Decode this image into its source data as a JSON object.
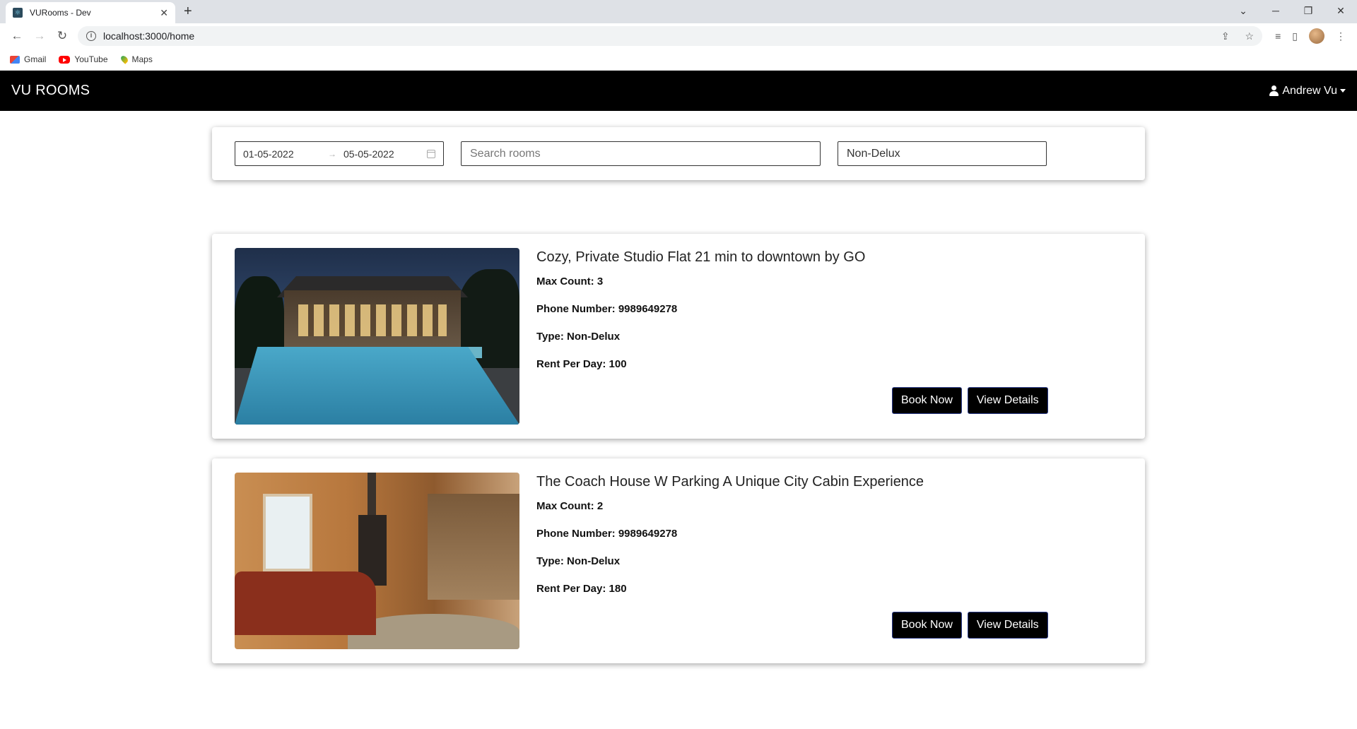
{
  "browser": {
    "tab_title": "VURooms - Dev",
    "url": "localhost:3000/home",
    "bookmarks": [
      "Gmail",
      "YouTube",
      "Maps"
    ]
  },
  "navbar": {
    "brand": "VU ROOMS",
    "user_name": "Andrew Vu"
  },
  "filters": {
    "date_from": "01-05-2022",
    "date_to": "05-05-2022",
    "search_placeholder": "Search rooms",
    "type_selected": "Non-Delux"
  },
  "rooms": [
    {
      "title": "Cozy, Private Studio Flat 21 min to downtown by GO",
      "max_count": "Max Count: 3",
      "phone": "Phone Number: 9989649278",
      "type": "Type: Non-Delux",
      "rent": "Rent Per Day: 100",
      "book_label": "Book Now",
      "details_label": "View Details"
    },
    {
      "title": "The Coach House W Parking A Unique City Cabin Experience",
      "max_count": "Max Count: 2",
      "phone": "Phone Number: 9989649278",
      "type": "Type: Non-Delux",
      "rent": "Rent Per Day: 180",
      "book_label": "Book Now",
      "details_label": "View Details"
    }
  ]
}
